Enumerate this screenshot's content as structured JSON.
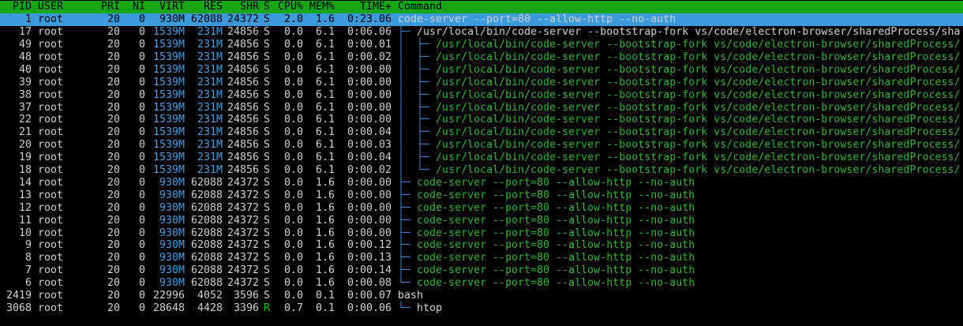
{
  "window": {
    "title": "htop"
  },
  "columns": {
    "pid": "PID",
    "user": "USER",
    "pri": "PRI",
    "ni": "NI",
    "virt": "VIRT",
    "res": "RES",
    "shr": "SHR",
    "s": "S",
    "cpu": "CPU%",
    "mem": "MEM%",
    "time": "TIME+",
    "cmd": "Command"
  },
  "colors": {
    "header_bg": "#17a615",
    "selected_bg": "#3b9ad9",
    "thread_cmd": "#2fb52f",
    "tree": "#3c84c9",
    "large_number": "#4a9fe0"
  },
  "processes": [
    {
      "pid": "1",
      "user": "root",
      "pri": "20",
      "ni": "0",
      "virt": "930M",
      "res": "62088",
      "shr": "24372",
      "s": "S",
      "cpu": "2.0",
      "mem": "1.6",
      "time": "0:23.06",
      "tree": "",
      "cmd": "code-server --port=80 --allow-http --no-auth",
      "selected": true
    },
    {
      "pid": "17",
      "user": "root",
      "pri": "20",
      "ni": "0",
      "virt": "1539M",
      "res": "231M",
      "shr": "24856",
      "s": "S",
      "cpu": "0.0",
      "mem": "6.1",
      "time": "0:06.06",
      "tree": "├─ ",
      "cmd": "/usr/local/bin/code-server --bootstrap-fork vs/code/electron-browser/sharedProcess/sha"
    },
    {
      "pid": "49",
      "user": "root",
      "pri": "20",
      "ni": "0",
      "virt": "1539M",
      "res": "231M",
      "shr": "24856",
      "s": "S",
      "cpu": "0.0",
      "mem": "6.1",
      "time": "0:00.01",
      "tree": "│  ├─ ",
      "cmd": "/usr/local/bin/code-server --bootstrap-fork vs/code/electron-browser/sharedProcess/"
    },
    {
      "pid": "48",
      "user": "root",
      "pri": "20",
      "ni": "0",
      "virt": "1539M",
      "res": "231M",
      "shr": "24856",
      "s": "S",
      "cpu": "0.0",
      "mem": "6.1",
      "time": "0:00.02",
      "tree": "│  ├─ ",
      "cmd": "/usr/local/bin/code-server --bootstrap-fork vs/code/electron-browser/sharedProcess/"
    },
    {
      "pid": "40",
      "user": "root",
      "pri": "20",
      "ni": "0",
      "virt": "1539M",
      "res": "231M",
      "shr": "24856",
      "s": "S",
      "cpu": "0.0",
      "mem": "6.1",
      "time": "0:00.00",
      "tree": "│  ├─ ",
      "cmd": "/usr/local/bin/code-server --bootstrap-fork vs/code/electron-browser/sharedProcess/"
    },
    {
      "pid": "39",
      "user": "root",
      "pri": "20",
      "ni": "0",
      "virt": "1539M",
      "res": "231M",
      "shr": "24856",
      "s": "S",
      "cpu": "0.0",
      "mem": "6.1",
      "time": "0:00.00",
      "tree": "│  ├─ ",
      "cmd": "/usr/local/bin/code-server --bootstrap-fork vs/code/electron-browser/sharedProcess/"
    },
    {
      "pid": "38",
      "user": "root",
      "pri": "20",
      "ni": "0",
      "virt": "1539M",
      "res": "231M",
      "shr": "24856",
      "s": "S",
      "cpu": "0.0",
      "mem": "6.1",
      "time": "0:00.00",
      "tree": "│  ├─ ",
      "cmd": "/usr/local/bin/code-server --bootstrap-fork vs/code/electron-browser/sharedProcess/"
    },
    {
      "pid": "37",
      "user": "root",
      "pri": "20",
      "ni": "0",
      "virt": "1539M",
      "res": "231M",
      "shr": "24856",
      "s": "S",
      "cpu": "0.0",
      "mem": "6.1",
      "time": "0:00.00",
      "tree": "│  ├─ ",
      "cmd": "/usr/local/bin/code-server --bootstrap-fork vs/code/electron-browser/sharedProcess/"
    },
    {
      "pid": "22",
      "user": "root",
      "pri": "20",
      "ni": "0",
      "virt": "1539M",
      "res": "231M",
      "shr": "24856",
      "s": "S",
      "cpu": "0.0",
      "mem": "6.1",
      "time": "0:00.00",
      "tree": "│  ├─ ",
      "cmd": "/usr/local/bin/code-server --bootstrap-fork vs/code/electron-browser/sharedProcess/"
    },
    {
      "pid": "21",
      "user": "root",
      "pri": "20",
      "ni": "0",
      "virt": "1539M",
      "res": "231M",
      "shr": "24856",
      "s": "S",
      "cpu": "0.0",
      "mem": "6.1",
      "time": "0:00.04",
      "tree": "│  ├─ ",
      "cmd": "/usr/local/bin/code-server --bootstrap-fork vs/code/electron-browser/sharedProcess/"
    },
    {
      "pid": "20",
      "user": "root",
      "pri": "20",
      "ni": "0",
      "virt": "1539M",
      "res": "231M",
      "shr": "24856",
      "s": "S",
      "cpu": "0.0",
      "mem": "6.1",
      "time": "0:00.03",
      "tree": "│  ├─ ",
      "cmd": "/usr/local/bin/code-server --bootstrap-fork vs/code/electron-browser/sharedProcess/"
    },
    {
      "pid": "19",
      "user": "root",
      "pri": "20",
      "ni": "0",
      "virt": "1539M",
      "res": "231M",
      "shr": "24856",
      "s": "S",
      "cpu": "0.0",
      "mem": "6.1",
      "time": "0:00.04",
      "tree": "│  ├─ ",
      "cmd": "/usr/local/bin/code-server --bootstrap-fork vs/code/electron-browser/sharedProcess/"
    },
    {
      "pid": "18",
      "user": "root",
      "pri": "20",
      "ni": "0",
      "virt": "1539M",
      "res": "231M",
      "shr": "24856",
      "s": "S",
      "cpu": "0.0",
      "mem": "6.1",
      "time": "0:00.02",
      "tree": "│  └─ ",
      "cmd": "/usr/local/bin/code-server --bootstrap-fork vs/code/electron-browser/sharedProcess/"
    },
    {
      "pid": "14",
      "user": "root",
      "pri": "20",
      "ni": "0",
      "virt": "930M",
      "res": "62088",
      "shr": "24372",
      "s": "S",
      "cpu": "0.0",
      "mem": "1.6",
      "time": "0:00.00",
      "tree": "├─ ",
      "cmd": "code-server --port=80 --allow-http --no-auth"
    },
    {
      "pid": "13",
      "user": "root",
      "pri": "20",
      "ni": "0",
      "virt": "930M",
      "res": "62088",
      "shr": "24372",
      "s": "S",
      "cpu": "0.0",
      "mem": "1.6",
      "time": "0:00.00",
      "tree": "├─ ",
      "cmd": "code-server --port=80 --allow-http --no-auth"
    },
    {
      "pid": "12",
      "user": "root",
      "pri": "20",
      "ni": "0",
      "virt": "930M",
      "res": "62088",
      "shr": "24372",
      "s": "S",
      "cpu": "0.0",
      "mem": "1.6",
      "time": "0:00.00",
      "tree": "├─ ",
      "cmd": "code-server --port=80 --allow-http --no-auth"
    },
    {
      "pid": "11",
      "user": "root",
      "pri": "20",
      "ni": "0",
      "virt": "930M",
      "res": "62088",
      "shr": "24372",
      "s": "S",
      "cpu": "0.0",
      "mem": "1.6",
      "time": "0:00.00",
      "tree": "├─ ",
      "cmd": "code-server --port=80 --allow-http --no-auth"
    },
    {
      "pid": "10",
      "user": "root",
      "pri": "20",
      "ni": "0",
      "virt": "930M",
      "res": "62088",
      "shr": "24372",
      "s": "S",
      "cpu": "0.0",
      "mem": "1.6",
      "time": "0:00.00",
      "tree": "├─ ",
      "cmd": "code-server --port=80 --allow-http --no-auth"
    },
    {
      "pid": "9",
      "user": "root",
      "pri": "20",
      "ni": "0",
      "virt": "930M",
      "res": "62088",
      "shr": "24372",
      "s": "S",
      "cpu": "0.0",
      "mem": "1.6",
      "time": "0:00.12",
      "tree": "├─ ",
      "cmd": "code-server --port=80 --allow-http --no-auth"
    },
    {
      "pid": "8",
      "user": "root",
      "pri": "20",
      "ni": "0",
      "virt": "930M",
      "res": "62088",
      "shr": "24372",
      "s": "S",
      "cpu": "0.0",
      "mem": "1.6",
      "time": "0:00.13",
      "tree": "├─ ",
      "cmd": "code-server --port=80 --allow-http --no-auth"
    },
    {
      "pid": "7",
      "user": "root",
      "pri": "20",
      "ni": "0",
      "virt": "930M",
      "res": "62088",
      "shr": "24372",
      "s": "S",
      "cpu": "0.0",
      "mem": "1.6",
      "time": "0:00.14",
      "tree": "├─ ",
      "cmd": "code-server --port=80 --allow-http --no-auth"
    },
    {
      "pid": "6",
      "user": "root",
      "pri": "20",
      "ni": "0",
      "virt": "930M",
      "res": "62088",
      "shr": "24372",
      "s": "S",
      "cpu": "0.0",
      "mem": "1.6",
      "time": "0:00.08",
      "tree": "└─ ",
      "cmd": "code-server --port=80 --allow-http --no-auth"
    },
    {
      "pid": "2419",
      "user": "root",
      "pri": "20",
      "ni": "0",
      "virt": "22996",
      "res": "4052",
      "shr": "3596",
      "s": "S",
      "cpu": "0.0",
      "mem": "0.1",
      "time": "0:00.07",
      "tree": "",
      "cmd": "bash",
      "plain": true
    },
    {
      "pid": "3068",
      "user": "root",
      "pri": "20",
      "ni": "0",
      "virt": "28648",
      "res": "4428",
      "shr": "3396",
      "s": "R",
      "cpu": "0.7",
      "mem": "0.1",
      "time": "0:00.06",
      "tree": "└─ ",
      "cmd": "htop",
      "plain": true
    }
  ]
}
